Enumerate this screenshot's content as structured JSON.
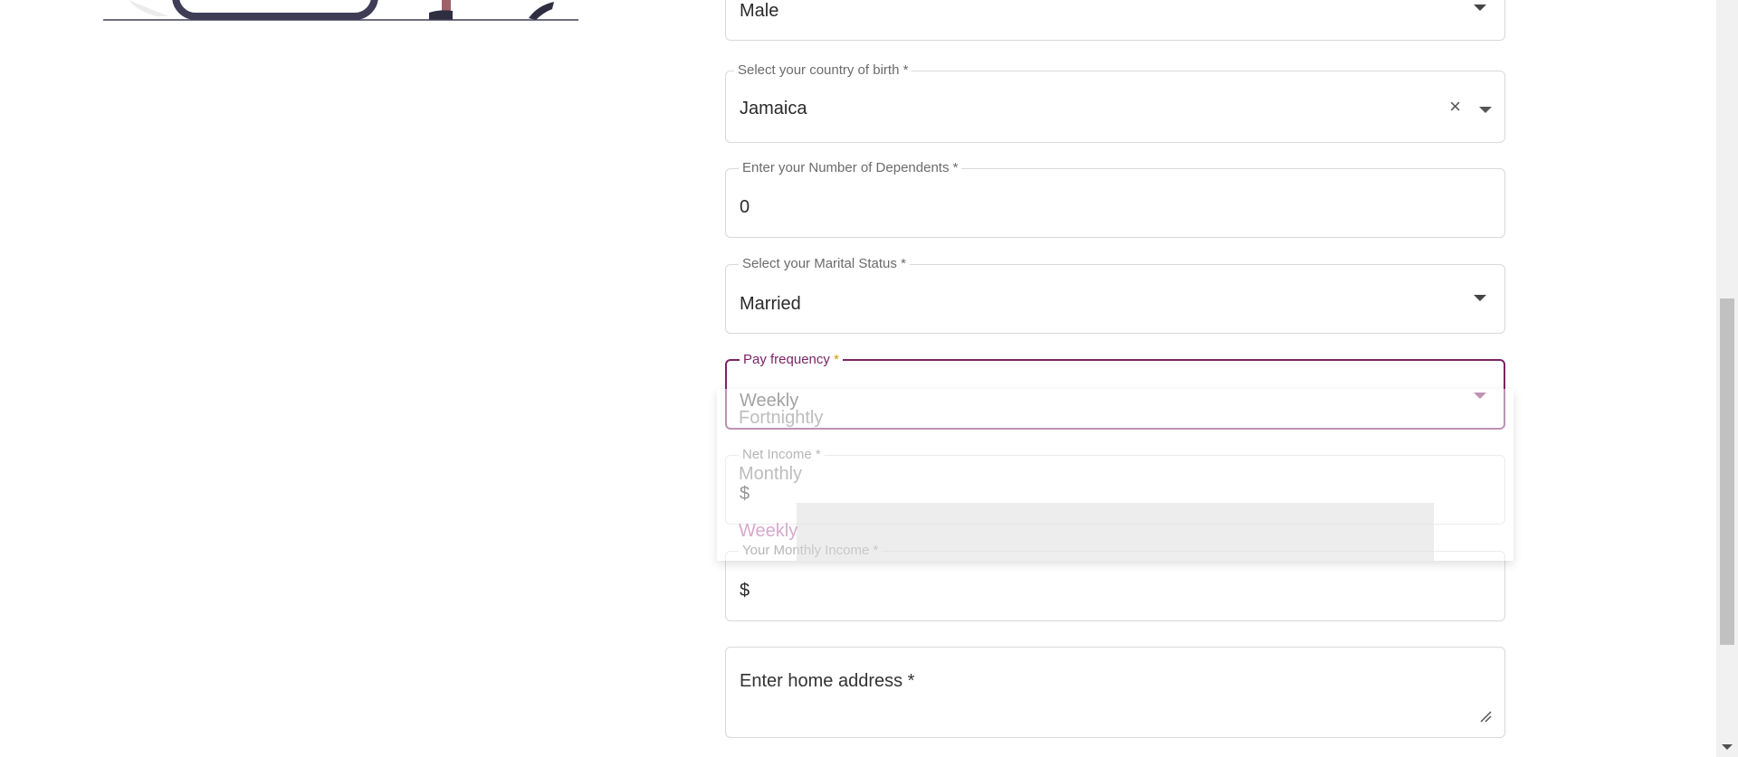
{
  "form": {
    "gender": {
      "value": "Male"
    },
    "country_of_birth": {
      "label": "Select your country of birth *",
      "value": "Jamaica"
    },
    "dependents": {
      "label": "Enter your Number of Dependents *",
      "value": "0"
    },
    "marital_status": {
      "label": "Select your Marital Status *",
      "value": "Married"
    },
    "pay_frequency": {
      "label": "Pay frequency",
      "required_mark": "*",
      "value": "Weekly"
    },
    "net_income": {
      "label": "Net Income *",
      "prefix": "$"
    },
    "monthly_income": {
      "label": "Your Monthly Income *",
      "prefix": "$"
    },
    "home_address": {
      "placeholder": "Enter home address *"
    }
  },
  "pay_frequency_menu": {
    "options": [
      "Fortnightly",
      "Monthly",
      "Weekly"
    ],
    "selected": "Weekly"
  },
  "colors": {
    "accent": "#7b2466",
    "required_asterisk": "#d29a00",
    "border": "#d9d9d9"
  },
  "icons": {
    "dropdown": "caret-down-icon",
    "clear": "clear-icon",
    "resize": "resize-handle-icon"
  }
}
